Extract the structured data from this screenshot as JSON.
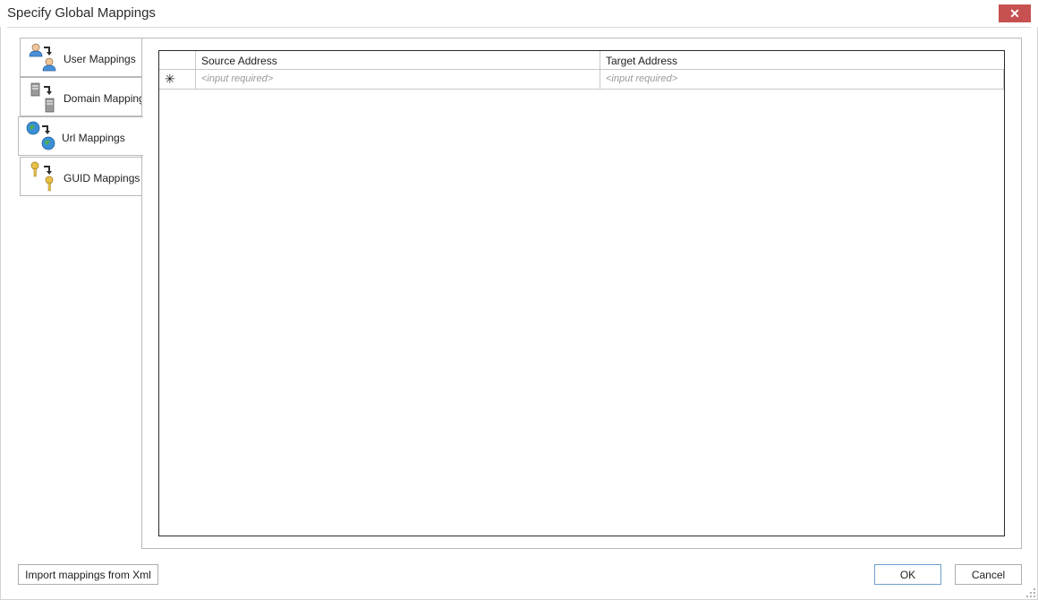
{
  "window": {
    "title": "Specify Global Mappings",
    "close_glyph": "✕"
  },
  "tabs": [
    {
      "label": "User Mappings",
      "icon": "user-mapping-icon",
      "selected": false
    },
    {
      "label": "Domain Mappings",
      "icon": "domain-mapping-icon",
      "selected": false
    },
    {
      "label": "Url Mappings",
      "icon": "url-mapping-icon",
      "selected": true
    },
    {
      "label": "GUID Mappings",
      "icon": "guid-mapping-icon",
      "selected": false
    }
  ],
  "grid": {
    "columns": [
      "Source Address",
      "Target Address"
    ],
    "new_row": {
      "indicator": "✳",
      "source_placeholder": "<input required>",
      "target_placeholder": "<input required>"
    }
  },
  "footer": {
    "import_label": "Import mappings from Xml",
    "ok_label": "OK",
    "cancel_label": "Cancel"
  },
  "colors": {
    "close_button": "#c75050",
    "border": "#b9b9b9",
    "default_button_border": "#6f9fd0",
    "placeholder_text": "#9a9a9a"
  }
}
